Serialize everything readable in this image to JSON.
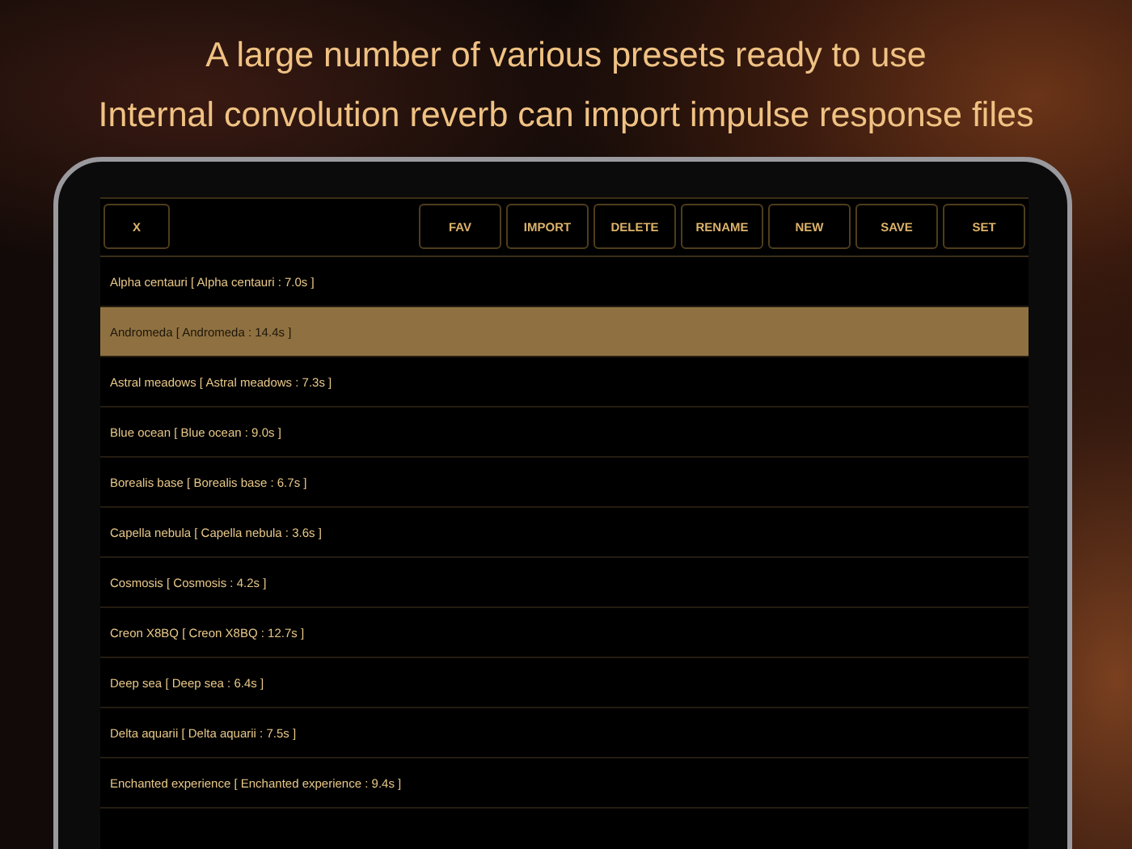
{
  "headline": [
    "A large number of various presets ready to use",
    "Internal convolution reverb can import impulse response files"
  ],
  "toolbar": {
    "close": "X",
    "buttons": [
      "FAV",
      "IMPORT",
      "DELETE",
      "RENAME",
      "NEW",
      "SAVE",
      "SET"
    ]
  },
  "presets": [
    {
      "label": "Alpha centauri [ Alpha centauri : 7.0s ]",
      "selected": false
    },
    {
      "label": "Andromeda [ Andromeda : 14.4s ]",
      "selected": true
    },
    {
      "label": "Astral meadows [ Astral meadows : 7.3s ]",
      "selected": false
    },
    {
      "label": "Blue ocean [ Blue ocean : 9.0s ]",
      "selected": false
    },
    {
      "label": "Borealis base [ Borealis base : 6.7s ]",
      "selected": false
    },
    {
      "label": "Capella nebula [ Capella nebula : 3.6s ]",
      "selected": false
    },
    {
      "label": "Cosmosis [ Cosmosis : 4.2s ]",
      "selected": false
    },
    {
      "label": "Creon X8BQ [ Creon X8BQ : 12.7s ]",
      "selected": false
    },
    {
      "label": "Deep sea [ Deep sea : 6.4s ]",
      "selected": false
    },
    {
      "label": "Delta aquarii [ Delta aquarii : 7.5s ]",
      "selected": false
    },
    {
      "label": "Enchanted experience [ Enchanted experience : 9.4s ]",
      "selected": false
    }
  ]
}
